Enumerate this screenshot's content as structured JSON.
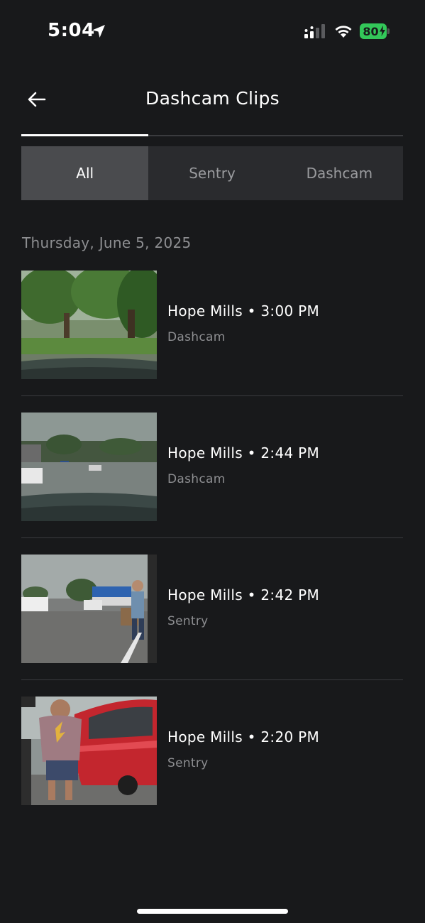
{
  "status": {
    "time": "5:04",
    "battery": "80"
  },
  "header": {
    "title": "Dashcam Clips"
  },
  "filters": [
    {
      "label": "All",
      "active": true
    },
    {
      "label": "Sentry",
      "active": false
    },
    {
      "label": "Dashcam",
      "active": false
    }
  ],
  "date_header": "Thursday, June 5, 2025",
  "clips": [
    {
      "title": "Hope Mills • 3:00 PM",
      "type": "Dashcam",
      "thumbnail": "park-trees"
    },
    {
      "title": "Hope Mills • 2:44 PM",
      "type": "Dashcam",
      "thumbnail": "parking-lot-cloudy"
    },
    {
      "title": "Hope Mills • 2:42 PM",
      "type": "Sentry",
      "thumbnail": "parking-lot-person-walking"
    },
    {
      "title": "Hope Mills • 2:20 PM",
      "type": "Sentry",
      "thumbnail": "person-by-red-car"
    }
  ],
  "colors": {
    "background": "#18191b",
    "segment_bg": "#2a2b2e",
    "segment_active": "#4a4b4e",
    "battery_green": "#33c759",
    "muted_text": "#8d8e91"
  }
}
